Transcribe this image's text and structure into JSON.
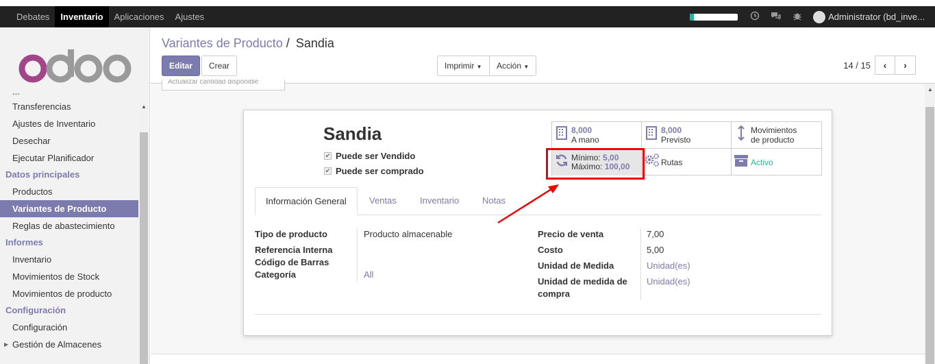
{
  "topbar": {
    "menus": [
      "Debates",
      "Inventario",
      "Aplicaciones",
      "Ajustes"
    ],
    "active_menu": "Inventario",
    "progress_fraction": 0.08,
    "user": "Administrator (bd_inve..."
  },
  "sidebar": {
    "truncated_item": "...",
    "items_top": [
      "Transferencias",
      "Ajustes de Inventario",
      "Desechar",
      "Ejecutar Planificador"
    ],
    "section_datos": "Datos principales",
    "items_datos": [
      "Productos",
      "Variantes de Producto",
      "Reglas de abastecimiento"
    ],
    "section_informes": "Informes",
    "items_informes": [
      "Inventario",
      "Movimientos de Stock",
      "Movimientos de producto"
    ],
    "section_config": "Configuración",
    "items_config": [
      "Configuración",
      "Gestión de Almacenes"
    ]
  },
  "control_panel": {
    "breadcrumb_parent": "Variantes de Producto",
    "breadcrumb_sep": "/",
    "breadcrumb_current": "Sandia",
    "edit_label": "Editar",
    "create_label": "Crear",
    "print_label": "Imprimir",
    "action_label": "Acción",
    "pager_value": "14 / 15"
  },
  "status_button": "Actualizar cantidad disponible",
  "product": {
    "name": "Sandia",
    "can_be_sold": "Puede ser Vendido",
    "can_be_purchased": "Puede ser comprado"
  },
  "stat_buttons": {
    "on_hand_value": "8,000",
    "on_hand_label": "A mano",
    "forecast_value": "8,000",
    "forecast_label": "Previsto",
    "moves_label_1": "Movimientos",
    "moves_label_2": "de producto",
    "min_label": "Mínimo:",
    "min_value": "5,00",
    "max_label": "Máximo:",
    "max_value": "100,00",
    "routes_label": "Rutas",
    "active_label": "Activo"
  },
  "tabs": [
    "Información General",
    "Ventas",
    "Inventario",
    "Notas"
  ],
  "general_info": {
    "type_label": "Tipo de producto",
    "type_value": "Producto almacenable",
    "ref_label": "Referencia Interna",
    "barcode_label": "Código de Barras",
    "category_label": "Categoría",
    "category_value": "All",
    "sale_price_label": "Precio de venta",
    "sale_price_value": "7,00",
    "cost_label": "Costo",
    "cost_value": "5,00",
    "uom_label": "Unidad de Medida",
    "uom_value": "Unidad(es)",
    "purchase_uom_label_1": "Unidad de medida de",
    "purchase_uom_label_2": "compra",
    "purchase_uom_value": "Unidad(es)"
  },
  "colors": {
    "brand": "#7c7bad",
    "highlight": "#e00000",
    "navbar": "#222222"
  }
}
